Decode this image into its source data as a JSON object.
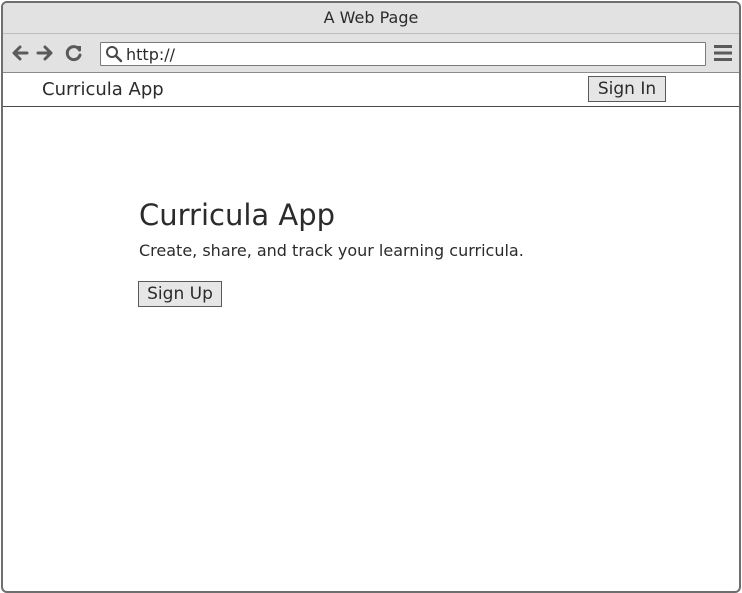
{
  "window": {
    "title": "A Web Page"
  },
  "toolbar": {
    "back_icon": "arrow-left-icon",
    "forward_icon": "arrow-right-icon",
    "reload_icon": "reload-icon",
    "search_icon": "search-icon",
    "url_value": "http://",
    "menu_icon": "hamburger-menu-icon"
  },
  "nav": {
    "brand": "Curricula App",
    "sign_in_label": "Sign In"
  },
  "hero": {
    "title": "Curricula App",
    "subtitle": "Create, share, and track your learning curricula.",
    "sign_up_label": "Sign Up"
  },
  "colors": {
    "chrome_bg": "#e2e2e2",
    "border": "#6e6e6e",
    "text": "#2b2b2b",
    "button_bg": "#e6e6e6"
  }
}
